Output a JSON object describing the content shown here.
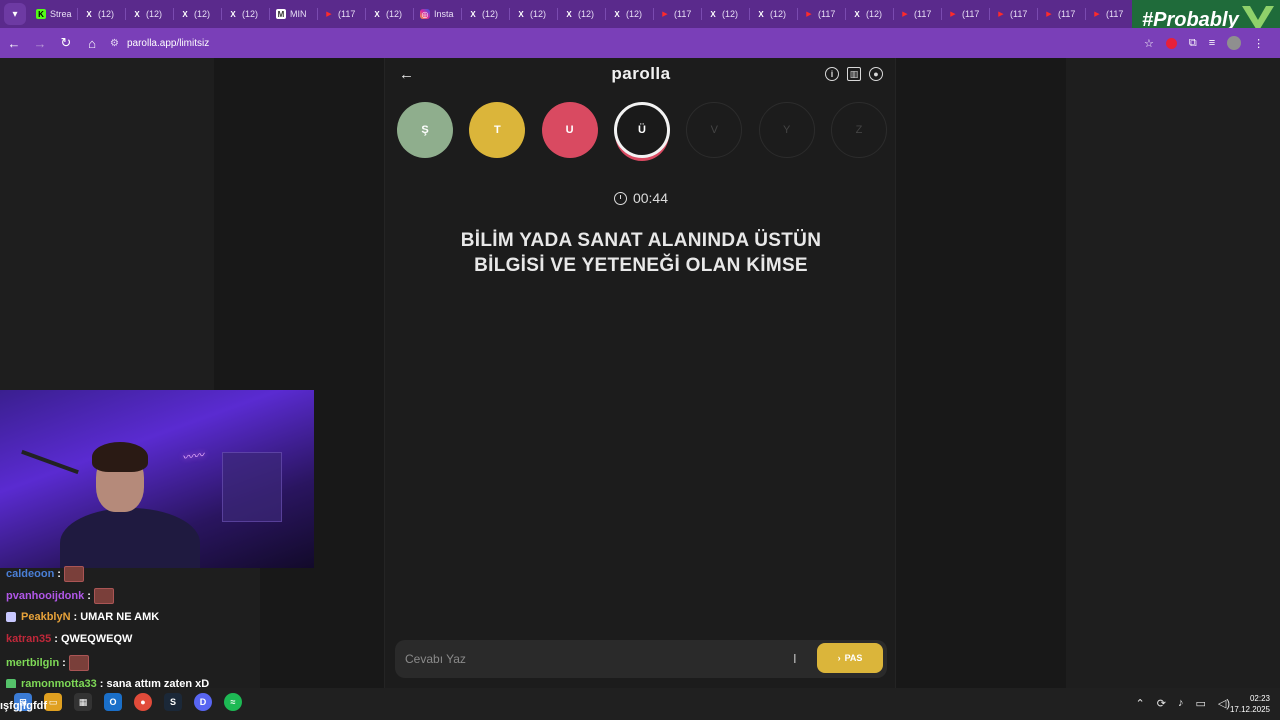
{
  "browser": {
    "tabs": [
      {
        "icon": "kick-icon",
        "label": "Strea"
      },
      {
        "icon": "x-icon",
        "label": "(12)"
      },
      {
        "icon": "x-icon",
        "label": "(12)"
      },
      {
        "icon": "x-icon",
        "label": "(12)"
      },
      {
        "icon": "x-icon",
        "label": "(12)"
      },
      {
        "icon": "mn-icon",
        "label": "MIN"
      },
      {
        "icon": "youtube-icon",
        "label": "(117"
      },
      {
        "icon": "x-icon",
        "label": "(12)"
      },
      {
        "icon": "instagram-icon",
        "label": "Insta"
      },
      {
        "icon": "x-icon",
        "label": "(12)"
      },
      {
        "icon": "x-icon",
        "label": "(12)"
      },
      {
        "icon": "x-icon",
        "label": "(12)"
      },
      {
        "icon": "x-icon",
        "label": "(12)"
      },
      {
        "icon": "youtube-icon",
        "label": "(117"
      },
      {
        "icon": "x-icon",
        "label": "(12)"
      },
      {
        "icon": "x-icon",
        "label": "(12)"
      },
      {
        "icon": "youtube-icon",
        "label": "(117"
      },
      {
        "icon": "x-icon",
        "label": "(12)"
      },
      {
        "icon": "youtube-icon",
        "label": "(117"
      },
      {
        "icon": "youtube-icon",
        "label": "(117"
      },
      {
        "icon": "youtube-icon",
        "label": "(117"
      },
      {
        "icon": "youtube-icon",
        "label": "(117"
      },
      {
        "icon": "youtube-icon",
        "label": "(117"
      },
      {
        "icon": "youtube-icon",
        "label": "(117"
      }
    ],
    "active_tab_close": "✕",
    "url": "parolla.app/limitsiz",
    "overlay_tag": "#Probably"
  },
  "app": {
    "brand": "parolla",
    "letters": [
      {
        "char": "Ş",
        "state": "correct"
      },
      {
        "char": "T",
        "state": "passed"
      },
      {
        "char": "U",
        "state": "wrong"
      },
      {
        "char": "Ü",
        "state": "active"
      },
      {
        "char": "V",
        "state": "idle"
      },
      {
        "char": "Y",
        "state": "idle"
      },
      {
        "char": "Z",
        "state": "idle"
      }
    ],
    "timer": "00:44",
    "question": "BİLİM YADA SANAT ALANINDA ÜSTÜN BİLGİSİ VE YETENEĞİ OLAN KİMSE",
    "answer_placeholder": "Cevabı Yaz",
    "pass_label": "PAS",
    "colors": {
      "correct": "#8fae8d",
      "passed": "#dbb53a",
      "wrong": "#d94a61"
    }
  },
  "chat": [
    {
      "user": "caldeoon",
      "user_color": "#4a7fd6",
      "text": "",
      "emote": true,
      "badge": ""
    },
    {
      "user": "pvanhooijdonk",
      "user_color": "#b157e8",
      "text": "",
      "emote": true,
      "badge": ""
    },
    {
      "user": "PeakblyN",
      "user_color": "#e8a33a",
      "text": "UMAR NE AMK",
      "emote": false,
      "badge": "sub"
    },
    {
      "user": "katran35",
      "user_color": "#c0283a",
      "text": "QWEQWEQW",
      "emote": false,
      "badge": ""
    },
    {
      "user": "mertbilgin",
      "user_color": "#7ed957",
      "text": "",
      "emote": true,
      "badge": ""
    },
    {
      "user": "ramonmotta33",
      "user_color": "#7ed957",
      "text": "sana attım zaten xD",
      "emote": false,
      "badge": "green"
    }
  ],
  "taskbar": {
    "left_text": "ışfgjfgfdf",
    "time": "02:23",
    "date": "17.12.2025"
  }
}
